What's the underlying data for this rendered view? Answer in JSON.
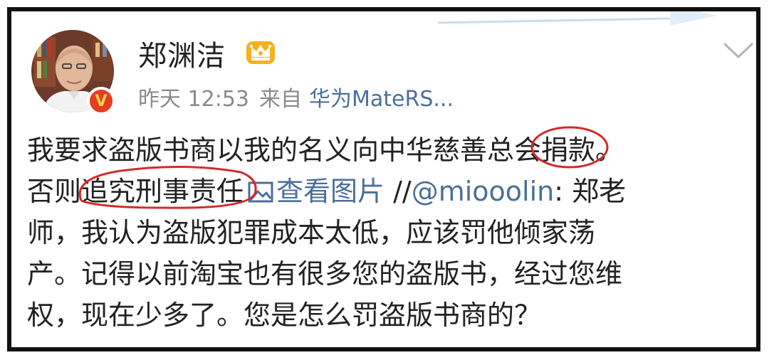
{
  "post": {
    "author": "郑渊洁",
    "time": "昨天 12:53",
    "from_label": "来自",
    "device": "华为MateRS...",
    "line1_before": "我要求盗版书商以我的名义向中华慈善总会",
    "line1_circled": "捐款",
    "line1_after": "。",
    "line2_before": "否则",
    "line2_circled": "追究刑事责任",
    "view_image": "查看图片",
    "repost_prefix": " //",
    "mention": "@miooolin",
    "line2_after": ": 郑老",
    "line3": "师，我认为盗版犯罪成本太低，应该罚他倾家荡",
    "line4": "产。记得以前淘宝也有很多您的盗版书，经过您维",
    "line5": "权，现在少多了。您是怎么罚盗版书商的？"
  },
  "icons": {
    "verified_badge": "V",
    "crown": "crown-icon",
    "chevron": "chevron-down-icon",
    "picture": "picture-icon"
  },
  "colors": {
    "link": "#4b6f9a",
    "annotation": "#d42a2a",
    "badge": "#e63c1f",
    "meta": "#8a8a8a"
  }
}
